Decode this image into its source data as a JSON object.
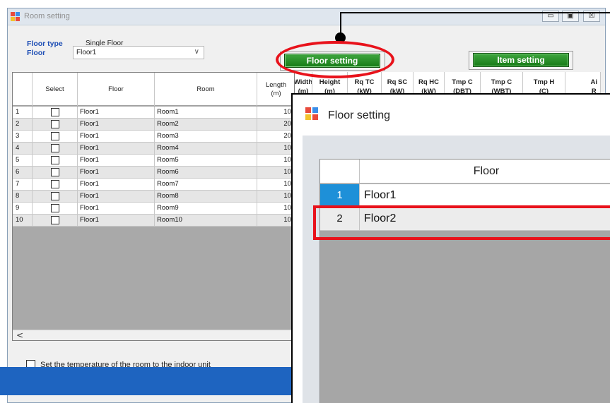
{
  "window": {
    "title": "Room setting",
    "controls": {
      "minimize": "▭",
      "maximize": "▣",
      "close": "☒"
    }
  },
  "form": {
    "floor_type_label": "Floor type",
    "floor_type_value": "Single Floor",
    "floor_label": "Floor",
    "floor_value": "Floor1",
    "floor_options_arrow": "∨"
  },
  "buttons": {
    "floor_setting": "Floor setting",
    "item_setting": "Item setting"
  },
  "grid": {
    "headers": {
      "select": "Select",
      "floor": "Floor",
      "room": "Room",
      "length_1": "Length",
      "length_2": "(m)"
    },
    "extra_headers": [
      {
        "line1": "Width",
        "line2": "(m)"
      },
      {
        "line1": "Height",
        "line2": "(m)"
      },
      {
        "line1": "Rq TC",
        "line2": "(kW)"
      },
      {
        "line1": "Rq SC",
        "line2": "(kW)"
      },
      {
        "line1": "Rq HC",
        "line2": "(kW)"
      },
      {
        "line1": "Tmp C",
        "line2": "(DBT)"
      },
      {
        "line1": "Tmp C",
        "line2": "(WBT)"
      },
      {
        "line1": "Tmp H",
        "line2": "(C)"
      },
      {
        "line1": "Ai",
        "line2": "R"
      }
    ],
    "rows": [
      {
        "n": "1",
        "floor": "Floor1",
        "room": "Room1",
        "length": "10"
      },
      {
        "n": "2",
        "floor": "Floor1",
        "room": "Room2",
        "length": "20"
      },
      {
        "n": "3",
        "floor": "Floor1",
        "room": "Room3",
        "length": "20"
      },
      {
        "n": "4",
        "floor": "Floor1",
        "room": "Room4",
        "length": "10"
      },
      {
        "n": "5",
        "floor": "Floor1",
        "room": "Room5",
        "length": "10"
      },
      {
        "n": "6",
        "floor": "Floor1",
        "room": "Room6",
        "length": "10"
      },
      {
        "n": "7",
        "floor": "Floor1",
        "room": "Room7",
        "length": "10"
      },
      {
        "n": "8",
        "floor": "Floor1",
        "room": "Room8",
        "length": "10"
      },
      {
        "n": "9",
        "floor": "Floor1",
        "room": "Room9",
        "length": "10"
      },
      {
        "n": "10",
        "floor": "Floor1",
        "room": "Room10",
        "length": "10"
      }
    ],
    "scroll_left": "<"
  },
  "bottom_option": "Set the temperature of the room to the indoor unit",
  "popup": {
    "title": "Floor setting",
    "header": "Floor",
    "rows": [
      {
        "n": "1",
        "floor": "Floor1",
        "selected": true
      },
      {
        "n": "2",
        "floor": "Floor2",
        "selected": false
      }
    ]
  },
  "colors": {
    "accent_blue": "#1f4fb5",
    "button_green": "#1e8a1e",
    "annotation_red": "#e8121b",
    "row_selected": "#1e90d8",
    "status_bar": "#1e64c0"
  }
}
